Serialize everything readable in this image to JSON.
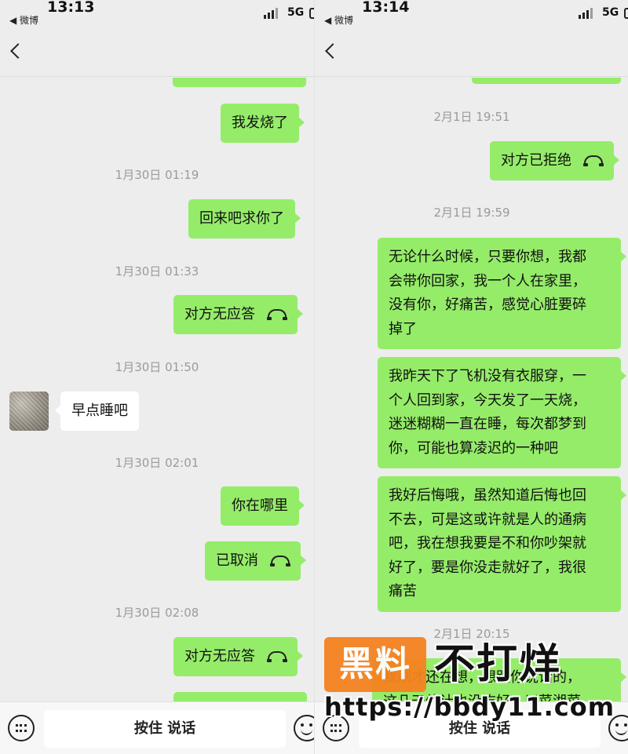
{
  "left": {
    "status": {
      "time": "13:13",
      "back_app": "◀ 微博",
      "network": "5G"
    },
    "messages": [
      {
        "type": "out",
        "text": "我发烧了"
      },
      {
        "type": "time",
        "text": "1月30日 01:19"
      },
      {
        "type": "out",
        "text": "回来吧求你了"
      },
      {
        "type": "time",
        "text": "1月30日 01:33"
      },
      {
        "type": "call",
        "text": "对方无应答"
      },
      {
        "type": "time",
        "text": "1月30日 01:50"
      },
      {
        "type": "in",
        "text": "早点睡吧"
      },
      {
        "type": "time",
        "text": "1月30日 02:01"
      },
      {
        "type": "out",
        "text": "你在哪里"
      },
      {
        "type": "call",
        "text": "已取消"
      },
      {
        "type": "time",
        "text": "1月30日 02:08"
      },
      {
        "type": "call",
        "text": "对方无应答"
      }
    ],
    "input": {
      "talk_label": "按住 说话"
    }
  },
  "right": {
    "status": {
      "time": "13:14",
      "back_app": "◀ 微博",
      "network": "5G"
    },
    "messages": [
      {
        "type": "time",
        "text": "2月1日 19:51"
      },
      {
        "type": "call",
        "text": "对方已拒绝"
      },
      {
        "type": "time",
        "text": "2月1日 19:59"
      },
      {
        "type": "out",
        "lines": [
          "无论什么时候，只要你想，我都",
          "会带你回家，我一个人在家里，",
          "没有你，好痛苦，感觉心脏要碎",
          "掉了"
        ]
      },
      {
        "type": "out",
        "lines": [
          "我昨天下了飞机没有衣服穿，一",
          "个人回到家，今天发了一天烧，",
          "迷迷糊糊一直在睡，每次都梦到",
          "你，可能也算凌迟的一种吧"
        ]
      },
      {
        "type": "out",
        "lines": [
          "我好后悔哦，虽然知道后悔也回",
          "不去，可是这或许就是人的通病",
          "吧，我在想我要是不和你吵架就",
          "好了，要是你没走就好了，我很",
          "痛苦"
        ]
      },
      {
        "type": "time",
        "text": "2月1日 20:15"
      },
      {
        "type": "out",
        "lines": [
          "我刚才还在想，想跟你说话的，",
          "这几天估计也没吃好，川菜湘菜"
        ]
      }
    ],
    "input": {
      "talk_label": "按住 说话"
    }
  },
  "watermark": {
    "badge": "黑料",
    "title": "不打烊",
    "url": "https://bbdy11.com"
  },
  "colors": {
    "outgoing_bubble": "#95ec69",
    "incoming_bubble": "#ffffff",
    "background": "#ededed",
    "watermark_orange": "#f58220"
  }
}
